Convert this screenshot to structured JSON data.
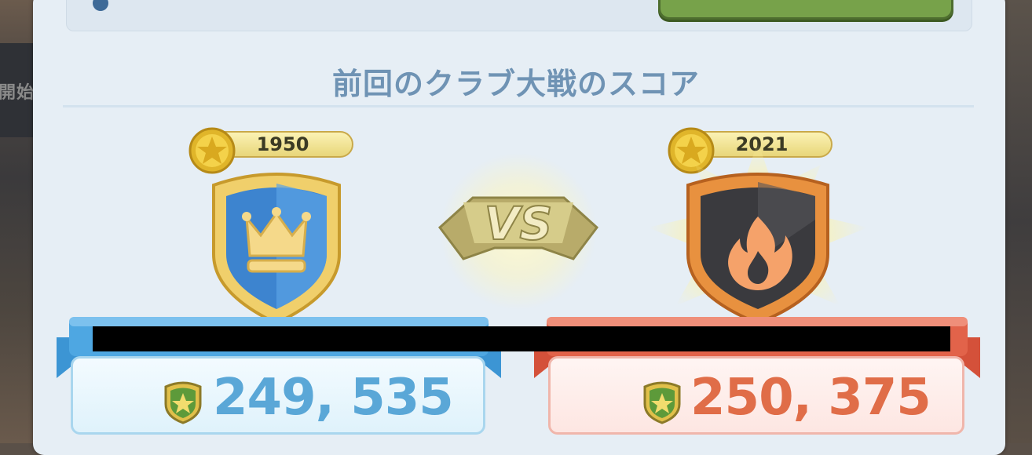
{
  "title": "前回のクラブ大戦のスコア",
  "background_left_text": "開始",
  "vs_label": "VS",
  "left_club": {
    "trophies": "1950",
    "score": "249, 535",
    "color": "#5aa7d7"
  },
  "right_club": {
    "trophies": "2021",
    "score": "250, 375",
    "color": "#e06d48"
  },
  "icons": [
    "star-trophy-icon",
    "crown-shield-badge",
    "fire-shield-badge",
    "vs-emblem",
    "star-shield-icon"
  ]
}
